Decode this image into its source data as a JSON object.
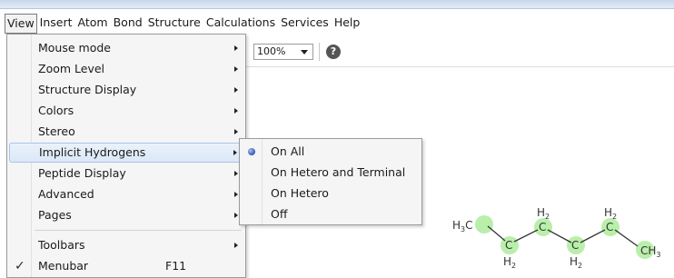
{
  "menubar": {
    "items": [
      "View",
      "Insert",
      "Atom",
      "Bond",
      "Structure",
      "Calculations",
      "Services",
      "Help"
    ],
    "active": "View"
  },
  "toolbar": {
    "zoom_value": "100%",
    "help_icon": "question-circle-icon"
  },
  "view_menu": {
    "items": [
      {
        "label": "Mouse mode",
        "submenu": true
      },
      {
        "label": "Zoom Level",
        "submenu": true
      },
      {
        "label": "Structure Display",
        "submenu": true
      },
      {
        "label": "Colors",
        "submenu": true
      },
      {
        "label": "Stereo",
        "submenu": true
      },
      {
        "label": "Implicit Hydrogens",
        "submenu": true,
        "highlighted": true
      },
      {
        "label": "Peptide Display",
        "submenu": true
      },
      {
        "label": "Advanced",
        "submenu": true
      },
      {
        "label": "Pages",
        "submenu": true
      },
      {
        "label": "Toolbars",
        "submenu": true
      },
      {
        "label": "Menubar",
        "shortcut": "F11",
        "checked": true
      }
    ]
  },
  "implicit_hydrogens_menu": {
    "items": [
      {
        "label": "On All",
        "selected": true
      },
      {
        "label": "On Hetero and Terminal"
      },
      {
        "label": "On Hetero"
      },
      {
        "label": "Off"
      }
    ]
  },
  "molecule": {
    "atoms": [
      {
        "symbol": "C",
        "hydrogens": "H3",
        "h_position": "left"
      },
      {
        "symbol": "C",
        "hydrogens": "H2",
        "h_position": "below"
      },
      {
        "symbol": "C",
        "hydrogens": "H2",
        "h_position": "above"
      },
      {
        "symbol": "C",
        "hydrogens": "H2",
        "h_position": "below"
      },
      {
        "symbol": "C",
        "hydrogens": "H2",
        "h_position": "above"
      },
      {
        "symbol": "C",
        "hydrogens": "H3",
        "h_position": "right"
      }
    ],
    "highlight_color": "#b9efaa",
    "bond_color": "#333333"
  },
  "colors": {
    "menu_highlight": "#dbe8f7",
    "radio": "#2f56b0"
  }
}
